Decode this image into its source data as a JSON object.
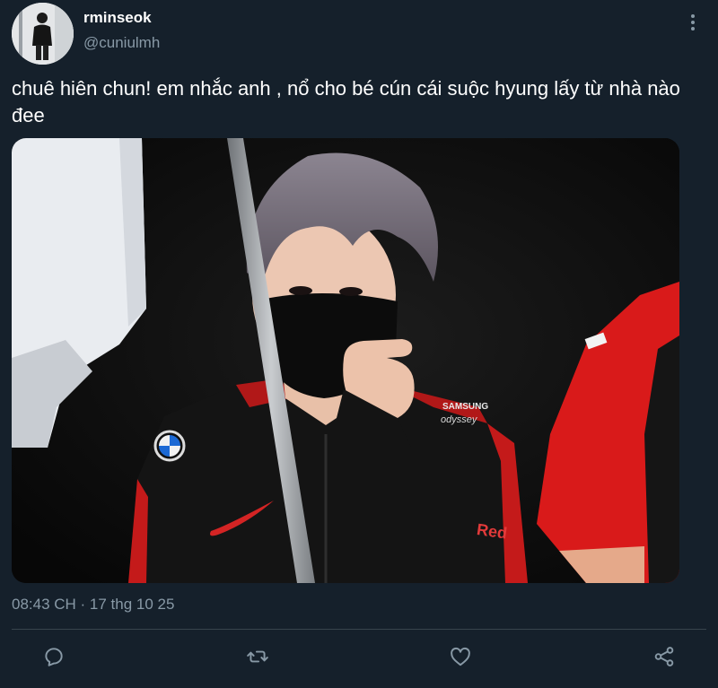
{
  "author": {
    "display_name": "rminseok",
    "handle": "@cuniulmh"
  },
  "tweet": {
    "text": "chuê hiên chun! em nhắc anh , nổ cho bé cún cái suộc hyung lấy từ nhà nào đee",
    "timestamp": "08:43 CH · 17 thg 10 25"
  },
  "media": {
    "jersey_sponsor_lines": [
      "SAMSUNG",
      "odyssey"
    ],
    "jersey_chest_text": "Red"
  },
  "icons": {
    "more": "more-vertical-icon",
    "reply": "reply-icon",
    "retweet": "retweet-icon",
    "like": "heart-icon",
    "share": "share-icon"
  },
  "colors": {
    "background": "#15202b",
    "secondary_text": "#8899a6",
    "divider": "#38444d"
  }
}
